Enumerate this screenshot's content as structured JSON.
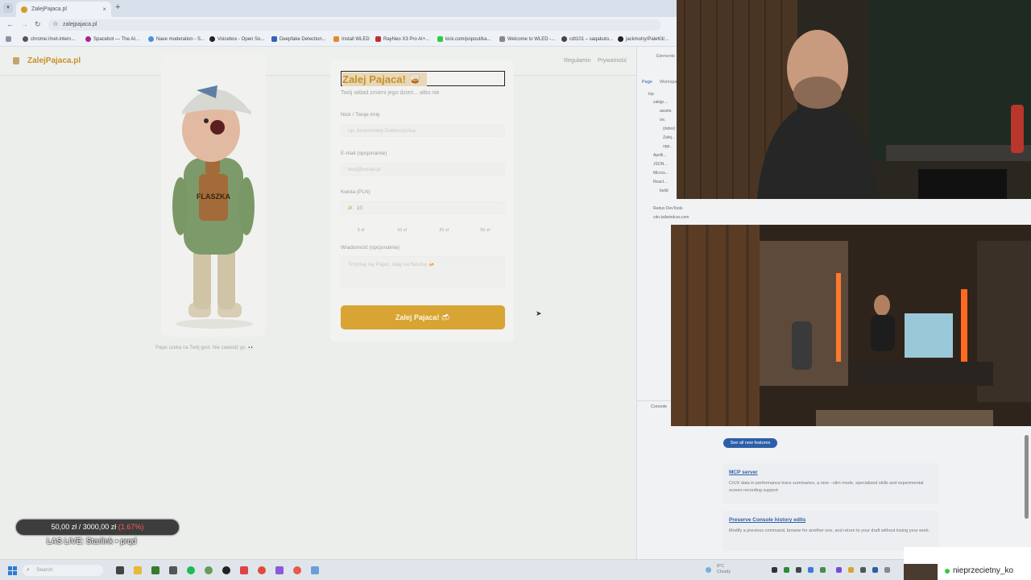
{
  "browser": {
    "tab_title": "ZalejPajaca.pl",
    "tab_close": "×",
    "new_tab": "+",
    "url": "zalejpajaca.pl",
    "bookmarks": [
      "chrome://net-intern...",
      "Spacebot — The AI...",
      "Nave moderation - S...",
      "Voicebox - Open So...",
      "Deepfake Detection...",
      "Install WLED",
      "RayNeo X3 Pro AI+...",
      "kick.com/popout/ka...",
      "Welcome to WLED -...",
      "cdt101 – saqakuto...",
      "jackmotry/PaleKit/..."
    ]
  },
  "site": {
    "logo": "ZalejPajaca.pl",
    "nav_regulamin": "Regulamin",
    "nav_prywatnosc": "Prywatność",
    "mascot_bottle_label": "FLASZKA",
    "mascot_caption": "Pajac czeka na Twój gest. Nie zawiedź go. 👀",
    "form": {
      "title": "Zalej Pajaca! 🥃",
      "subtitle": "Twój wkład zmieni jego dzień... albo nie",
      "nick_label": "Nick / Twoje imię",
      "nick_placeholder": "np. Anonimowy Dobroczyńca",
      "email_label": "E-mail (opcjonalnie)",
      "email_placeholder": "twoj@email.pl",
      "amount_label": "Kwota (PLN)",
      "amount_currency": "zł",
      "amount_value": "10",
      "quick_amounts": [
        "5 zł",
        "10 zł",
        "20 zł",
        "50 zł"
      ],
      "message_label": "Wiadomość (opcjonalnie)",
      "message_placeholder": "Trzymaj się Pajac, daję na flaszkę 🍻",
      "submit_label": "Zalej Pajaca! 🍻"
    }
  },
  "devtools": {
    "tabs": [
      "Elements",
      "Page",
      "Workspace"
    ],
    "tree": [
      "top",
      "zalejp...",
      "assets",
      "src",
      "(index)",
      "Zalej...",
      "opp...",
      "Apolli...",
      "JSON...",
      "Micros...",
      "React...",
      "build",
      "Redux DevTools",
      "cdn.tailwindcss.com"
    ],
    "console_label": "Console",
    "see_features": "See all new features",
    "features": [
      {
        "title": "MCP server",
        "desc": "CrUX data in performance trace summaries, a new --slim mode, specialized skills and experimental screen recording support"
      },
      {
        "title": "Preserve Console history edits",
        "desc": "Modify a previous command, browse for another one, and return to your draft without losing your work."
      }
    ]
  },
  "overlay": {
    "donation_current": "50,00 zł",
    "donation_sep": "/",
    "donation_goal": "3000,00 zł",
    "donation_pct": "(1.67%)",
    "live_text": "LAS LIVE: Starlink • prqd"
  },
  "taskbar": {
    "search": "Search",
    "weather_temp": "8°C",
    "weather_desc": "Cloudy",
    "streamer_name": "nieprzecietny_ko"
  },
  "colors": {
    "brand": "#c8902a",
    "submit": "#d8a433",
    "devtools_link": "#2c5fa9",
    "live_dot": "#2ecc40"
  }
}
